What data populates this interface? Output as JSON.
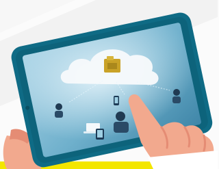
{
  "scene": {
    "description_icons": [
      "cloud-icon",
      "folder-icon",
      "person-icon",
      "laptop-icon",
      "tablet-icon"
    ],
    "colors": {
      "background": "#fbfbfb",
      "stripe_yellow": "#f3e600",
      "tablet_frame": "#0f6b85",
      "screen_light": "#a9d3e6",
      "screen_dark": "#4a90b0",
      "cloud": "#f6f9fb",
      "folder": "#c9a227",
      "skin": "#f2a98e",
      "skin_shadow": "#e58c74"
    }
  }
}
